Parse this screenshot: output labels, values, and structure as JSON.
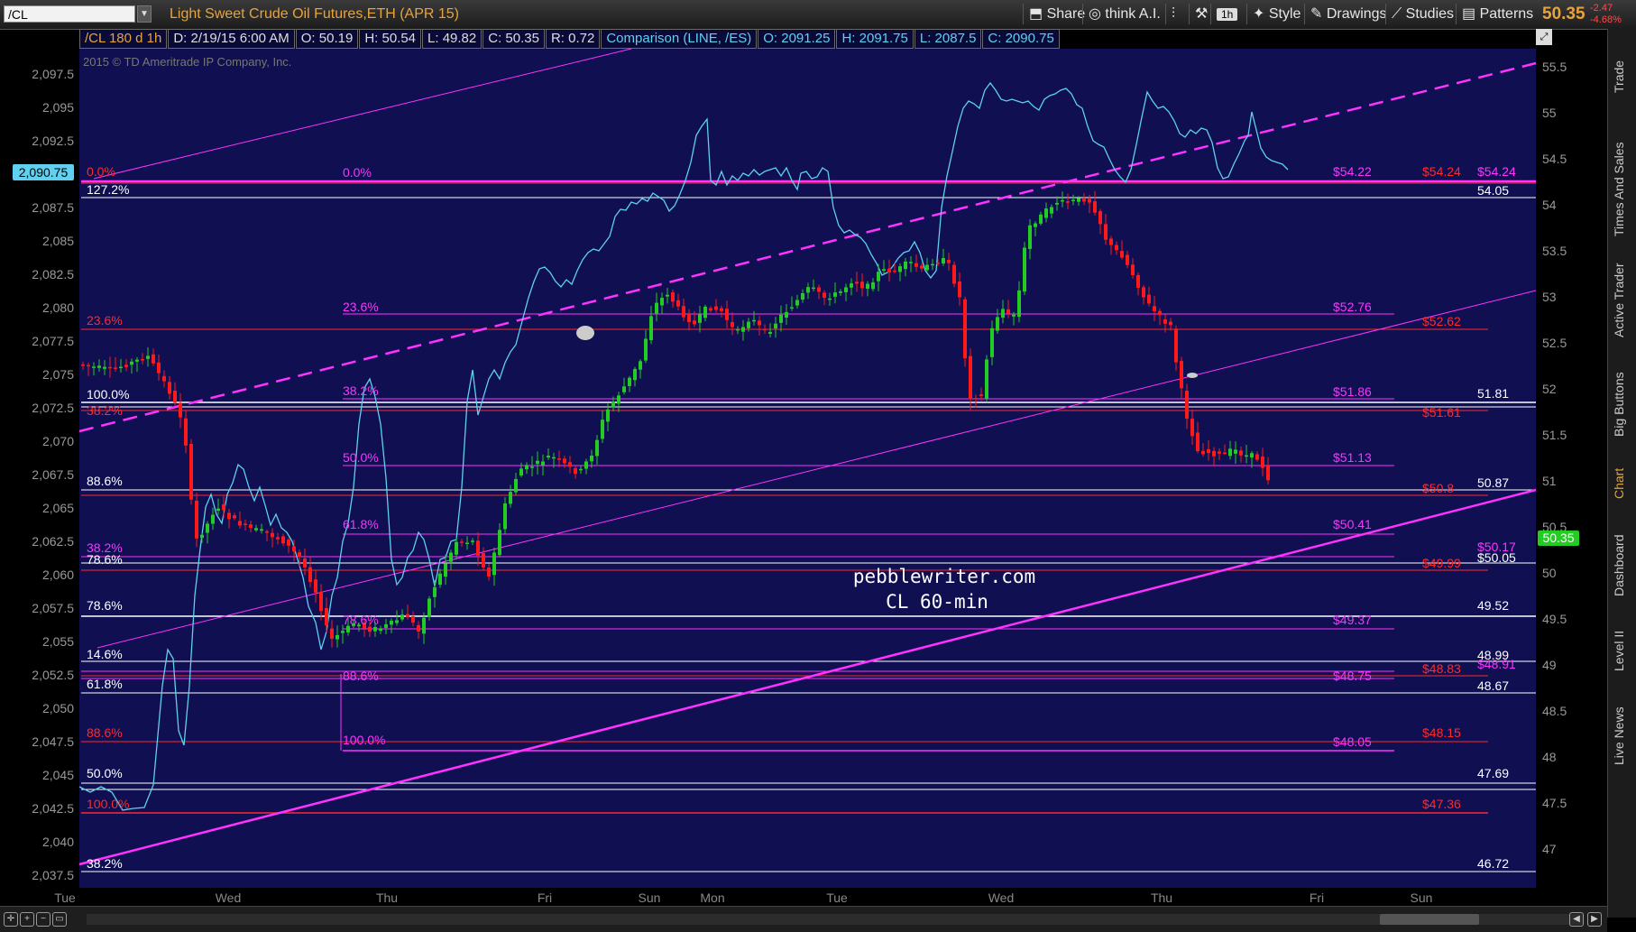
{
  "toolbar": {
    "symbol": "/CL",
    "instrument": "Light Sweet Crude Oil Futures,ETH (APR 15)",
    "share": "Share",
    "think": "think A.I.",
    "period": "1h",
    "style": "Style",
    "drawings": "Drawings",
    "studies": "Studies",
    "patterns": "Patterns",
    "last": "50.35",
    "change": "-2.47",
    "change_pct": "-4.68%"
  },
  "infobar": {
    "symbol": "/CL 180 d 1h",
    "date": "D: 2/19/15 6:00 AM",
    "open": "O: 50.19",
    "high": "H: 50.54",
    "low": "L: 49.82",
    "close": "C: 50.35",
    "range": "R: 0.72",
    "comparison": "Comparison (LINE, /ES)",
    "c_open": "O: 2091.25",
    "c_high": "H: 2091.75",
    "c_low": "L: 2087.5",
    "c_close": "C: 2090.75"
  },
  "chart": {
    "copyright": "2015 © TD Ameritrade IP Company, Inc.",
    "watermark1": "pebblewriter.com",
    "watermark2": "CL 60-min",
    "left_axis": [
      "2,097.5",
      "2,095",
      "2,092.5",
      "2,090",
      "2,087.5",
      "2,085",
      "2,082.5",
      "2,080",
      "2,077.5",
      "2,075",
      "2,072.5",
      "2,070",
      "2,067.5",
      "2,065",
      "2,062.5",
      "2,060",
      "2,057.5",
      "2,055",
      "2,052.5",
      "2,050",
      "2,047.5",
      "2,045",
      "2,042.5",
      "2,040",
      "2,037.5"
    ],
    "left_marker": "2,090.75",
    "right_axis": [
      "55.5",
      "55",
      "54.5",
      "54",
      "53.5",
      "53",
      "52.5",
      "52",
      "51.5",
      "51",
      "50.5",
      "50",
      "49.5",
      "49",
      "48.5",
      "48",
      "47.5",
      "47"
    ],
    "right_marker": "50.35",
    "days": [
      "Tue",
      "Wed",
      "Thu",
      "Fri",
      "Sun",
      "Mon",
      "Tue",
      "Wed",
      "Thu",
      "Fri",
      "Sun"
    ],
    "colors": {
      "bg": "#0f0f52",
      "magenta": "#ff33ff",
      "red": "#ff2a2a",
      "white": "#ffffff",
      "cyan": "#5fd0f0",
      "up": "#22cc22",
      "down": "#ff1a1a"
    },
    "fib_labels": [
      {
        "t": "0.0%",
        "c": "red"
      },
      {
        "t": "127.2%",
        "c": "white"
      },
      {
        "t": "100.0%",
        "c": "white"
      },
      {
        "t": "23.6%",
        "c": "red"
      },
      {
        "t": "38.2%",
        "c": "red"
      },
      {
        "t": "88.6%",
        "c": "white"
      },
      {
        "t": "38.2%",
        "c": "magenta"
      },
      {
        "t": "78.6%",
        "c": "white"
      },
      {
        "t": "78.6%",
        "c": "white"
      },
      {
        "t": "14.6%",
        "c": "white"
      },
      {
        "t": "61.8%",
        "c": "white"
      },
      {
        "t": "88.6%",
        "c": "red"
      },
      {
        "t": "50.0%",
        "c": "white"
      },
      {
        "t": "100.0%",
        "c": "red"
      },
      {
        "t": "38.2%",
        "c": "white"
      },
      {
        "t": "0.0%",
        "c": "magenta"
      },
      {
        "t": "23.6%",
        "c": "magenta"
      },
      {
        "t": "38.2%",
        "c": "magenta"
      },
      {
        "t": "50.0%",
        "c": "magenta"
      },
      {
        "t": "61.8%",
        "c": "magenta"
      },
      {
        "t": "78.6%",
        "c": "magenta"
      },
      {
        "t": "88.6%",
        "c": "magenta"
      },
      {
        "t": "100.0%",
        "c": "magenta"
      }
    ],
    "price_labels": [
      {
        "t": "$54.22",
        "c": "magenta"
      },
      {
        "t": "$54.24",
        "c": "red"
      },
      {
        "t": "$54.24",
        "c": "magenta"
      },
      {
        "t": "54.05",
        "c": "white"
      },
      {
        "t": "$52.76",
        "c": "magenta"
      },
      {
        "t": "$52.62",
        "c": "red"
      },
      {
        "t": "$51.86",
        "c": "magenta"
      },
      {
        "t": "51.81",
        "c": "white"
      },
      {
        "t": "$51.61",
        "c": "red"
      },
      {
        "t": "$51.13",
        "c": "magenta"
      },
      {
        "t": "50.87",
        "c": "white"
      },
      {
        "t": "$50.8",
        "c": "red"
      },
      {
        "t": "$50.41",
        "c": "magenta"
      },
      {
        "t": "$50.17",
        "c": "magenta"
      },
      {
        "t": "$50.05",
        "c": "white"
      },
      {
        "t": "$49.99",
        "c": "red"
      },
      {
        "t": "49.52",
        "c": "white"
      },
      {
        "t": "$49.37",
        "c": "magenta"
      },
      {
        "t": "48.99",
        "c": "white"
      },
      {
        "t": "$48.91",
        "c": "magenta"
      },
      {
        "t": "$48.83",
        "c": "red"
      },
      {
        "t": "$48.75",
        "c": "magenta"
      },
      {
        "t": "48.67",
        "c": "white"
      },
      {
        "t": "$48.15",
        "c": "red"
      },
      {
        "t": "$48.05",
        "c": "magenta"
      },
      {
        "t": "47.69",
        "c": "white"
      },
      {
        "t": "$47.36",
        "c": "red"
      },
      {
        "t": "46.72",
        "c": "white"
      }
    ]
  },
  "sidebar": [
    "Trade",
    "Times And Sales",
    "Active Trader",
    "Big Buttons",
    "Chart",
    "Dashboard",
    "Level II",
    "Live News"
  ]
}
